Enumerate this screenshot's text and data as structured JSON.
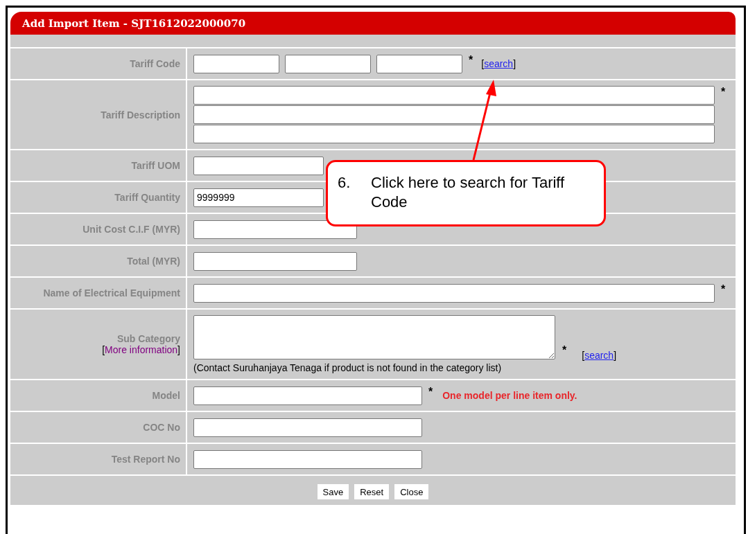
{
  "dialog": {
    "title": "Add Import Item - SJT1612022000070"
  },
  "rows": [
    {
      "kind": "code",
      "label": "Tariff Code",
      "required": "*",
      "link": [
        "[",
        "search",
        "]"
      ]
    },
    {
      "kind": "description",
      "label": "Tariff Description",
      "required": "*"
    },
    {
      "kind": "quantity",
      "label": "Tariff UOM"
    },
    {
      "kind": "quantity",
      "label": "Tariff Quantity",
      "value": "9999999"
    },
    {
      "kind": "short",
      "label": "Unit Cost C.I.F (MYR)"
    },
    {
      "kind": "short",
      "label": "Total (MYR)"
    },
    {
      "kind": "long",
      "label": "Name of Electrical Equipment",
      "required": "*"
    },
    {
      "kind": "textarea",
      "label": "Sub Category",
      "label_link": [
        "[",
        "More information",
        "]"
      ],
      "required": "*",
      "link": [
        "[",
        "search",
        "]"
      ],
      "hint": "(Contact Suruhanjaya Tenaga if product is not found in the category list)"
    },
    {
      "kind": "medium",
      "label": "Model",
      "required": "*",
      "note": "One model per line item only."
    },
    {
      "kind": "medium",
      "label": "COC No"
    },
    {
      "kind": "medium",
      "label": "Test Report No"
    }
  ],
  "buttons": [
    "Save",
    "Reset",
    "Close"
  ],
  "callout": {
    "number": "6.",
    "text": "Click here to search for Tariff Code"
  }
}
